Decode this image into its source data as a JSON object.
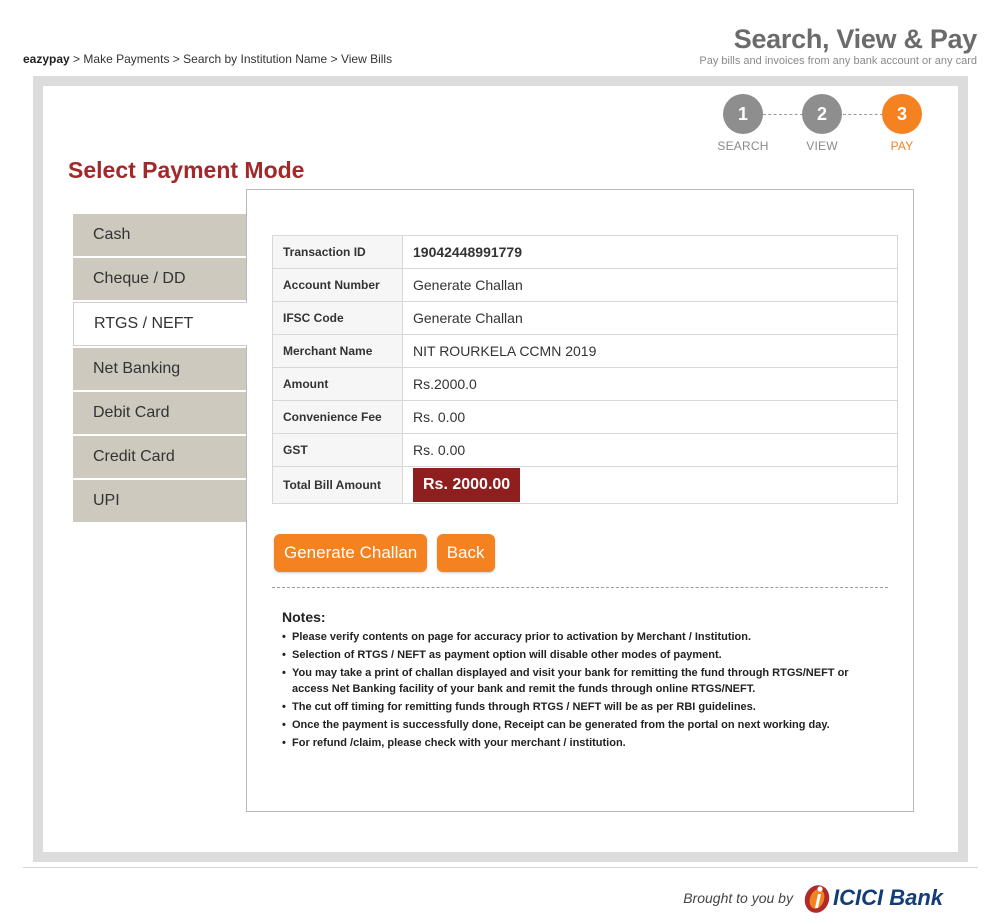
{
  "breadcrumb": {
    "home": "eazypay",
    "separator": ">",
    "items": [
      "Make Payments",
      "Search by Institution Name",
      "View Bills"
    ]
  },
  "brand": {
    "title": "Search, View & Pay",
    "subtitle": "Pay bills and invoices from any bank account or any card"
  },
  "stepper": {
    "steps": [
      {
        "number": "1",
        "label": "SEARCH",
        "active": false
      },
      {
        "number": "2",
        "label": "VIEW",
        "active": false
      },
      {
        "number": "3",
        "label": "PAY",
        "active": true
      }
    ],
    "active_color": "#f58220",
    "inactive_color": "#8e8e8e"
  },
  "page_title": "Select Payment Mode",
  "tabs": [
    {
      "label": "Cash",
      "active": false
    },
    {
      "label": "Cheque / DD",
      "active": false
    },
    {
      "label": "RTGS / NEFT",
      "active": true
    },
    {
      "label": "Net Banking",
      "active": false
    },
    {
      "label": "Debit Card",
      "active": false
    },
    {
      "label": "Credit Card",
      "active": false
    },
    {
      "label": "UPI",
      "active": false
    }
  ],
  "details": {
    "rows": [
      {
        "key": "Transaction ID",
        "value": "19042448991779"
      },
      {
        "key": "Account Number",
        "value": "Generate Challan"
      },
      {
        "key": "IFSC Code",
        "value": "Generate Challan"
      },
      {
        "key": "Merchant Name",
        "value": "NIT ROURKELA CCMN 2019"
      },
      {
        "key": "Amount",
        "value": "Rs.2000.0"
      },
      {
        "key": "Convenience Fee",
        "value": "Rs. 0.00"
      },
      {
        "key": "GST",
        "value": "Rs. 0.00"
      },
      {
        "key": "Total Bill Amount",
        "value": "Rs. 2000.00"
      }
    ]
  },
  "actions": {
    "generate_label": "Generate Challan",
    "back_label": "Back"
  },
  "notes": {
    "title": "Notes:",
    "items": [
      "Please verify contents on page for accuracy prior to activation by Merchant / Institution.",
      "Selection of RTGS / NEFT as payment option will disable other modes of payment.",
      "You may take a print of challan displayed and visit your bank for remitting the fund through RTGS/NEFT or access Net Banking facility of your bank and remit the funds through online RTGS/NEFT.",
      "The cut off timing for remitting funds through RTGS / NEFT will be as per RBI guidelines.",
      "Once the payment is successfully done, Receipt can be generated from the portal on next working day.",
      "For refund /claim, please check with your merchant / institution."
    ]
  },
  "footer": {
    "brought_by": "Brought to you by",
    "bank_name": "ICICI Bank",
    "logo_icon": "icici-logo-icon"
  },
  "colors": {
    "title_red": "#a3282a",
    "accent_orange": "#f58220",
    "total_badge": "#8e1f1e",
    "tab_bg": "#cdc9be",
    "bank_blue": "#133d78"
  }
}
